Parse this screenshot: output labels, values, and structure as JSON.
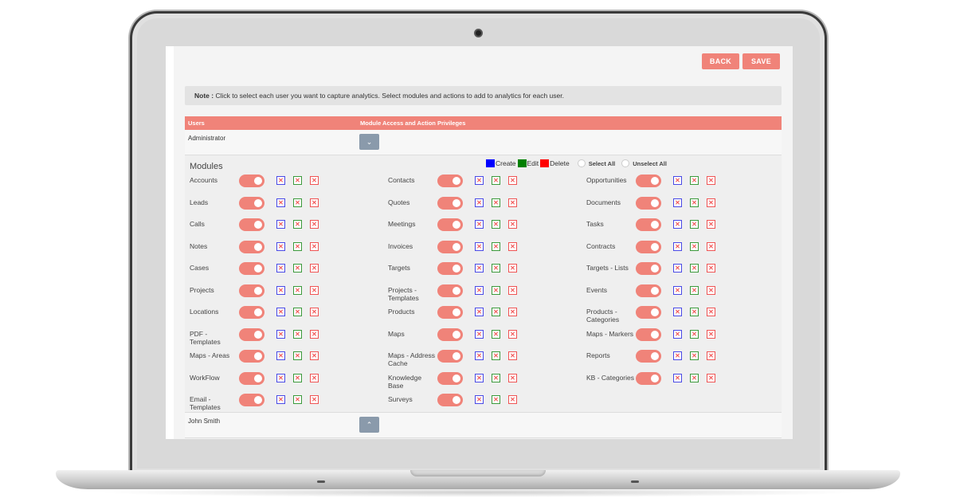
{
  "toolbar": {
    "back_label": "BACK",
    "save_label": "SAVE"
  },
  "note": {
    "prefix": "Note :",
    "text": " Click to select each user you want to capture analytics. Select modules and actions to add to analytics for each user."
  },
  "table": {
    "col_users": "Users",
    "col_privileges": "Module Access and Action Privileges"
  },
  "users": [
    {
      "name": "Administrator",
      "expanded": true,
      "toggle_icon": "chevron-down"
    },
    {
      "name": "John Smith",
      "expanded": false,
      "toggle_icon": "chevron-up"
    }
  ],
  "modules_title": "Modules",
  "legend": {
    "create": "Create",
    "edit": "Edit",
    "delete": "Delete",
    "select_all": "Select All",
    "unselect_all": "Unselect All",
    "colors": {
      "create": "#0000ff",
      "edit": "#008000",
      "delete": "#ff0000"
    }
  },
  "accent_color": "#f08379",
  "modules": {
    "col1": [
      "Accounts",
      "Leads",
      "Calls",
      "Notes",
      "Cases",
      "Projects",
      "Locations",
      "PDF - Templates",
      "Maps - Areas",
      "WorkFlow",
      "Email - Templates"
    ],
    "col2": [
      "Contacts",
      "Quotes",
      "Meetings",
      "Invoices",
      "Targets",
      "Projects - Templates",
      "Products",
      "Maps",
      "Maps - Address Cache",
      "Knowledge Base",
      "Surveys"
    ],
    "col3": [
      "Opportunities",
      "Documents",
      "Tasks",
      "Contracts",
      "Targets - Lists",
      "Events",
      "Products - Categories",
      "Maps - Markers",
      "Reports",
      "KB - Categories"
    ]
  },
  "module_state": {
    "enabled": true,
    "create": false,
    "edit": false,
    "delete": false
  },
  "checkbox_glyph": "✕"
}
